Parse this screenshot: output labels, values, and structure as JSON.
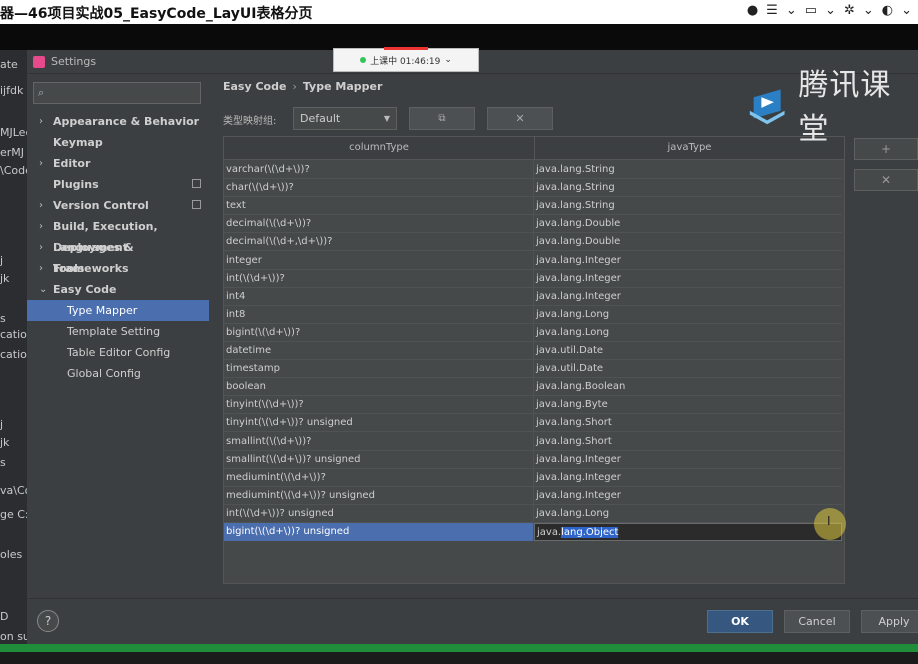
{
  "video": {
    "title": "器—46项目实战05_EasyCode_LayUI表格分页",
    "controls": [
      "●",
      "☰",
      "⌄",
      "▭",
      "⌄",
      "✲",
      "⌄",
      "◐",
      "⌄"
    ]
  },
  "live": {
    "status": "上课中 01:46:19",
    "chev": "⌄"
  },
  "watermark": {
    "text": "腾讯课堂",
    "colors": {
      "blue": "#2b7fc4",
      "light": "#7ec4ee"
    }
  },
  "ide_left": [
    "ate",
    "ijfdk",
    "MJLec",
    "erMJ",
    "\\Code",
    "j",
    "jk",
    "s",
    "cation",
    "catior",
    "j",
    "jk",
    "s",
    "va\\Co",
    "ge C:",
    "oles",
    "D",
    "on suc"
  ],
  "settings": {
    "window_title": "Settings",
    "search_icon": "search-icon",
    "nav": [
      {
        "label": "Appearance & Behavior",
        "arrow": "›",
        "type": "item"
      },
      {
        "label": "Keymap",
        "arrow": "",
        "type": "item"
      },
      {
        "label": "Editor",
        "arrow": "›",
        "type": "item"
      },
      {
        "label": "Plugins",
        "arrow": "",
        "type": "item",
        "copy": true
      },
      {
        "label": "Version Control",
        "arrow": "›",
        "type": "item",
        "copy": true
      },
      {
        "label": "Build, Execution, Deployment",
        "arrow": "›",
        "type": "item"
      },
      {
        "label": "Languages & Frameworks",
        "arrow": "›",
        "type": "item"
      },
      {
        "label": "Tools",
        "arrow": "›",
        "type": "item"
      },
      {
        "label": "Easy Code",
        "arrow": "⌄",
        "type": "item"
      },
      {
        "label": "Type Mapper",
        "type": "sub",
        "selected": true
      },
      {
        "label": "Template Setting",
        "type": "sub"
      },
      {
        "label": "Table Editor Config",
        "type": "sub"
      },
      {
        "label": "Global Config",
        "type": "sub"
      }
    ],
    "breadcrumb": {
      "root": "Easy Code",
      "sep": "›",
      "page": "Type Mapper"
    },
    "group_label": "类型映射组:",
    "group_value": "Default",
    "copy_icon": "⧉",
    "delete_icon": "✕",
    "columns": [
      "columnType",
      "javaType"
    ],
    "rows": [
      [
        "varchar(\\(\\d+\\))?",
        "java.lang.String"
      ],
      [
        "char(\\(\\d+\\))?",
        "java.lang.String"
      ],
      [
        "text",
        "java.lang.String"
      ],
      [
        "decimal(\\(\\d+\\))?",
        "java.lang.Double"
      ],
      [
        "decimal(\\(\\d+,\\d+\\))?",
        "java.lang.Double"
      ],
      [
        "integer",
        "java.lang.Integer"
      ],
      [
        "int(\\(\\d+\\))?",
        "java.lang.Integer"
      ],
      [
        "int4",
        "java.lang.Integer"
      ],
      [
        "int8",
        "java.lang.Long"
      ],
      [
        "bigint(\\(\\d+\\))?",
        "java.lang.Long"
      ],
      [
        "datetime",
        "java.util.Date"
      ],
      [
        "timestamp",
        "java.util.Date"
      ],
      [
        "boolean",
        "java.lang.Boolean"
      ],
      [
        "tinyint(\\(\\d+\\))?",
        "java.lang.Byte"
      ],
      [
        "tinyint(\\(\\d+\\))? unsigned",
        "java.lang.Short"
      ],
      [
        "smallint(\\(\\d+\\))?",
        "java.lang.Short"
      ],
      [
        "smallint(\\(\\d+\\))? unsigned",
        "java.lang.Integer"
      ],
      [
        "mediumint(\\(\\d+\\))?",
        "java.lang.Integer"
      ],
      [
        "mediumint(\\(\\d+\\))? unsigned",
        "java.lang.Integer"
      ],
      [
        "int(\\(\\d+\\))? unsigned",
        "java.lang.Long"
      ],
      [
        "bigint(\\(\\d+\\))? unsigned",
        "java.lang.Object"
      ]
    ],
    "selected_row": 20,
    "selected_prefix": "java.",
    "selected_highlight": "lang.Object",
    "add_icon": "+",
    "remove_icon": "✕",
    "help": "?",
    "buttons": {
      "ok": "OK",
      "cancel": "Cancel",
      "apply": "Apply"
    }
  }
}
